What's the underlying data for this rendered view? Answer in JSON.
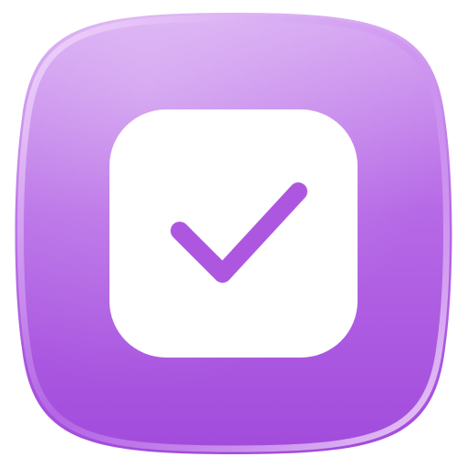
{
  "icon": {
    "name": "checkbox-checked-icon",
    "colors": {
      "tile_top": "#d6a6f2",
      "tile_mid": "#b669e6",
      "tile_bottom": "#a24bdc",
      "rim_light": "#f3ddfb",
      "rim_shadow": "#8a35c4",
      "inner_box": "#ffffff",
      "check": "#ad57e0"
    }
  }
}
